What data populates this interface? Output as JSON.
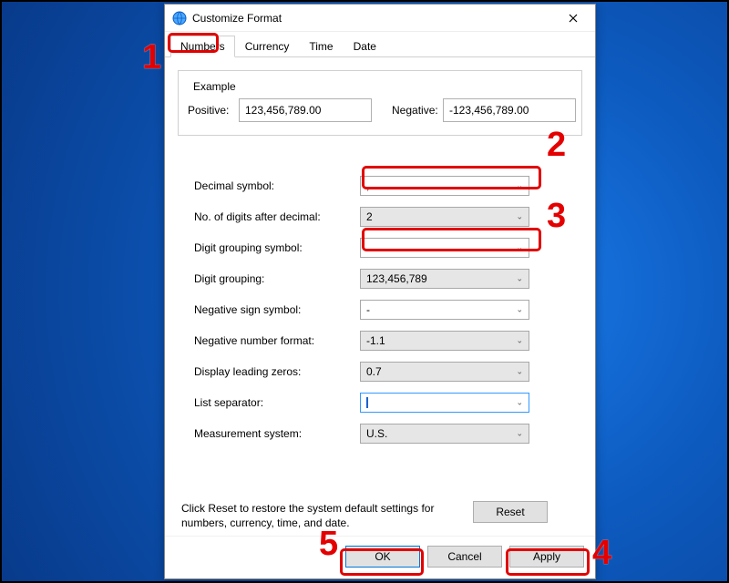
{
  "window": {
    "title": "Customize Format"
  },
  "tabs": {
    "numbers": "Numbers",
    "currency": "Currency",
    "time": "Time",
    "date": "Date"
  },
  "example": {
    "legend": "Example",
    "positive_label": "Positive:",
    "positive_value": "123,456,789.00",
    "negative_label": "Negative:",
    "negative_value": "-123,456,789.00"
  },
  "settings": {
    "decimal_symbol": {
      "label": "Decimal symbol:",
      "value": ","
    },
    "digits_after": {
      "label": "No. of digits after decimal:",
      "value": "2"
    },
    "grouping_symbol": {
      "label": "Digit grouping symbol:",
      "value": "."
    },
    "digit_grouping": {
      "label": "Digit grouping:",
      "value": "123,456,789"
    },
    "neg_sign": {
      "label": "Negative sign symbol:",
      "value": "-"
    },
    "neg_format": {
      "label": "Negative number format:",
      "value": "-1.1"
    },
    "leading_zeros": {
      "label": "Display leading zeros:",
      "value": "0.7"
    },
    "list_sep": {
      "label": "List separator:",
      "value": ""
    },
    "measurement": {
      "label": "Measurement system:",
      "value": "U.S."
    }
  },
  "footer": {
    "note": "Click Reset to restore the system default settings for numbers, currency, time, and date.",
    "reset": "Reset"
  },
  "buttons": {
    "ok": "OK",
    "cancel": "Cancel",
    "apply": "Apply"
  },
  "annotations": {
    "n1": "1",
    "n2": "2",
    "n3": "3",
    "n4": "4",
    "n5": "5"
  }
}
